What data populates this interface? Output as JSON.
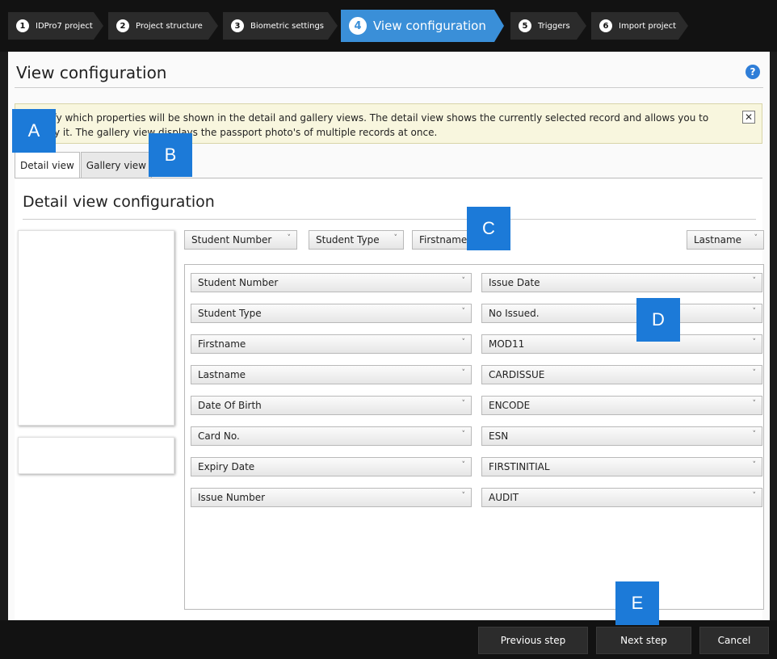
{
  "steps": [
    {
      "num": "1",
      "label": "IDPro7 project"
    },
    {
      "num": "2",
      "label": "Project structure"
    },
    {
      "num": "3",
      "label": "Biometric settings"
    },
    {
      "num": "4",
      "label": "View configuration"
    },
    {
      "num": "5",
      "label": "Triggers"
    },
    {
      "num": "6",
      "label": "Import project"
    }
  ],
  "page": {
    "title": "View configuration",
    "help_icon": "?"
  },
  "info": {
    "text": "Specify which properties will be shown in the detail and gallery views. The detail view shows the currently selected record and allows you to modify it. The gallery view displays the passport photo's of multiple records at once.",
    "close": "✕"
  },
  "tabs": [
    {
      "label": "Detail view"
    },
    {
      "label": "Gallery view"
    }
  ],
  "detail": {
    "section_title": "Detail view configuration",
    "header_fields": [
      "Student Number",
      "Student Type",
      "Firstname",
      "Lastname"
    ],
    "left_fields": [
      "Student Number",
      "Student Type",
      "Firstname",
      "Lastname",
      "Date Of Birth",
      "Card No.",
      "Expiry Date",
      "Issue Number"
    ],
    "right_fields": [
      "Issue Date",
      "No Issued.",
      "MOD11",
      "CARDISSUE",
      "ENCODE",
      "ESN",
      "FIRSTINITIAL",
      "AUDIT"
    ],
    "chevron": "˅"
  },
  "buttons": {
    "previous": "Previous step",
    "next": "Next step",
    "cancel": "Cancel"
  },
  "callouts": [
    "A",
    "B",
    "C",
    "D",
    "E"
  ],
  "colors": {
    "active_step": "#3a8fd8",
    "callout": "#1c7ad8",
    "info_bg": "#f8f6de"
  }
}
